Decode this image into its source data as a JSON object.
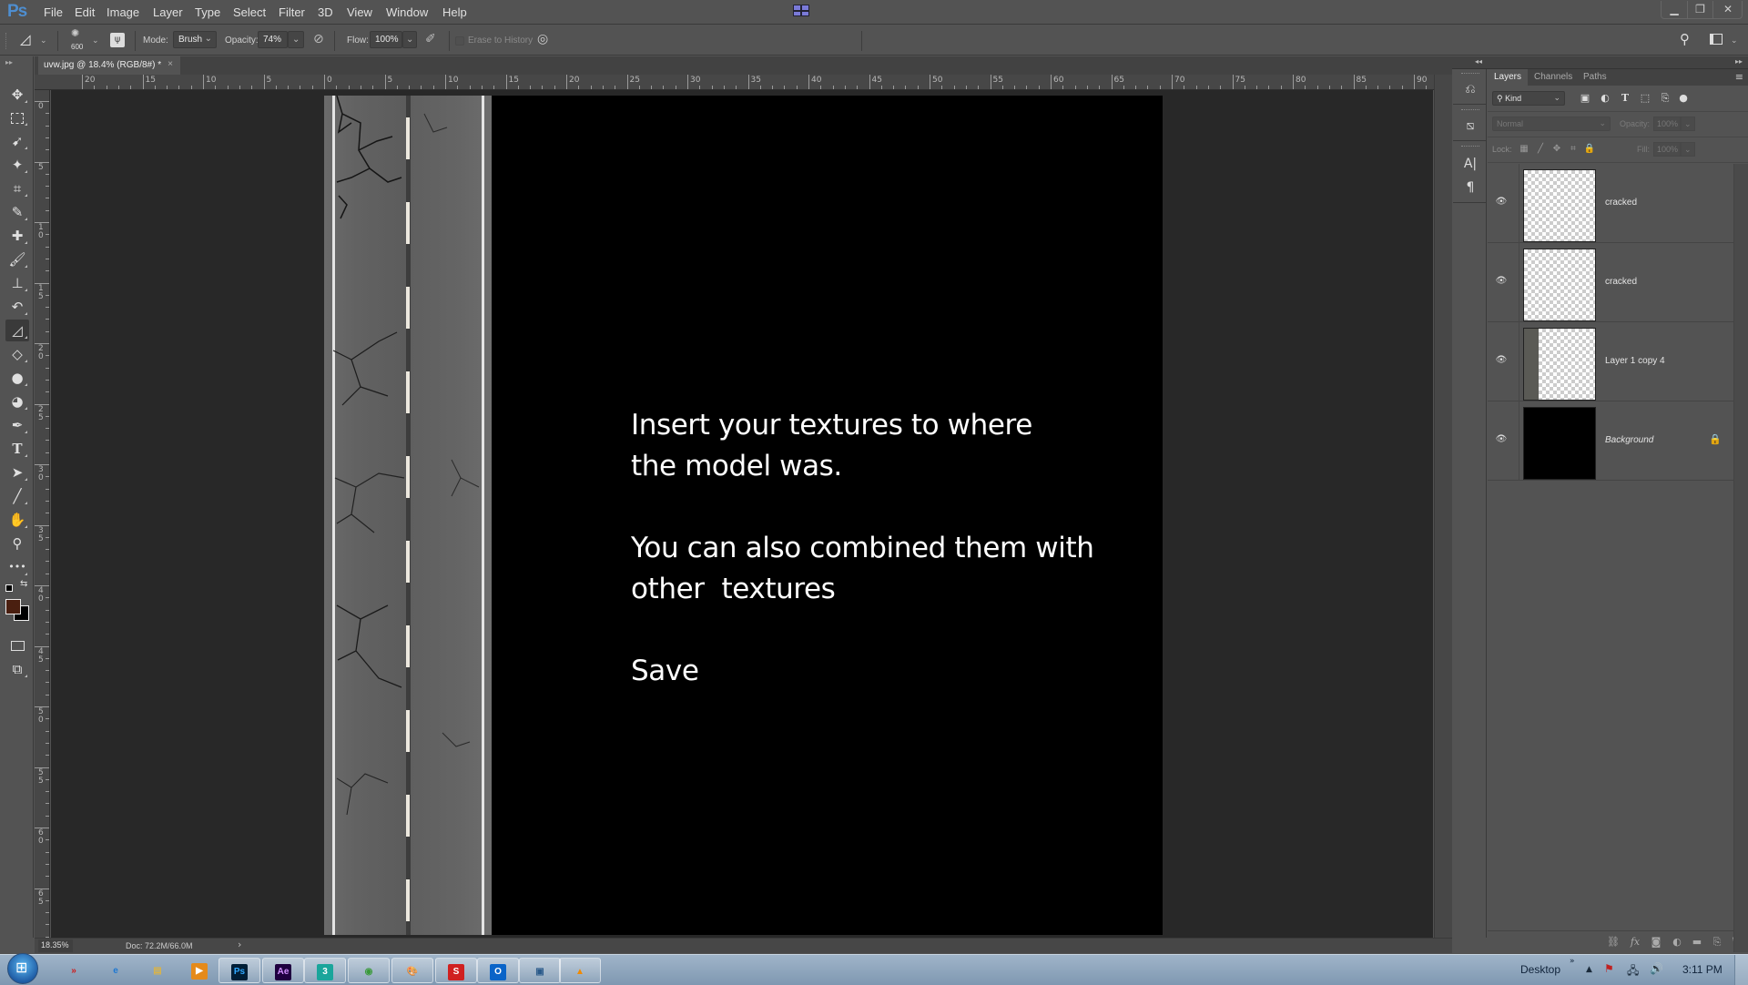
{
  "app": {
    "logo": "Ps",
    "menu": [
      "File",
      "Edit",
      "Image",
      "Layer",
      "Type",
      "Select",
      "Filter",
      "3D",
      "View",
      "Window",
      "Help"
    ],
    "window_buttons": {
      "minimize": "▁",
      "restore": "❐",
      "close": "✕"
    }
  },
  "options_bar": {
    "tool_icon": "eraser-icon",
    "brush_size": "600",
    "mode_label": "Mode:",
    "mode_value": "Brush",
    "opacity_label": "Opacity:",
    "opacity_value": "74%",
    "flow_label": "Flow:",
    "flow_value": "100%",
    "erase_to_history_label": "Erase to History",
    "erase_to_history_checked": false
  },
  "document_tab": {
    "title": "uvw.jpg @ 18.4% (RGB/8#) *",
    "close": "×"
  },
  "rulers": {
    "top": [
      "20",
      "15",
      "10",
      "5",
      "0",
      "5",
      "10",
      "15",
      "20",
      "25",
      "30",
      "35",
      "40",
      "45",
      "50",
      "55",
      "60",
      "65",
      "70",
      "75",
      "80",
      "85",
      "90"
    ],
    "left": [
      "0",
      "5",
      "10",
      "15",
      "20",
      "25",
      "30",
      "35",
      "40",
      "45",
      "50",
      "55",
      "60",
      "65"
    ]
  },
  "toolbar": {
    "tools": [
      {
        "name": "move-tool",
        "glyph": "✥"
      },
      {
        "name": "marquee-tool",
        "glyph": "⬚"
      },
      {
        "name": "lasso-tool",
        "glyph": "➹"
      },
      {
        "name": "magic-wand-tool",
        "glyph": "⁄"
      },
      {
        "name": "crop-tool",
        "glyph": "⌗"
      },
      {
        "name": "eyedropper-tool",
        "glyph": "⁄"
      },
      {
        "name": "healing-brush-tool",
        "glyph": "✚"
      },
      {
        "name": "brush-tool",
        "glyph": "╱"
      },
      {
        "name": "clone-stamp-tool",
        "glyph": "⊥"
      },
      {
        "name": "history-brush-tool",
        "glyph": "↶"
      },
      {
        "name": "eraser-tool",
        "glyph": "◿"
      },
      {
        "name": "paint-bucket-tool",
        "glyph": "◇"
      },
      {
        "name": "blur-tool",
        "glyph": "💧"
      },
      {
        "name": "dodge-tool",
        "glyph": "●"
      },
      {
        "name": "pen-tool",
        "glyph": "✒"
      },
      {
        "name": "type-tool",
        "glyph": "T"
      },
      {
        "name": "path-selection-tool",
        "glyph": "➤"
      },
      {
        "name": "line-tool",
        "glyph": "╱"
      },
      {
        "name": "hand-tool",
        "glyph": "✋"
      },
      {
        "name": "zoom-tool",
        "glyph": "⚲"
      },
      {
        "name": "more-tools",
        "glyph": "•••"
      }
    ],
    "active_tool": "eraser-tool",
    "foreground_color": "#4a1f10",
    "background_color": "#000000"
  },
  "canvas": {
    "instructions": "Insert your textures to where\nthe model was.\n\nYou can also combined them with\nother  textures\n\nSave"
  },
  "status_bar": {
    "zoom": "18.35%",
    "doc_info": "Doc: 72.2M/66.0M",
    "arrow": "›"
  },
  "layers_panel": {
    "tabs": [
      "Layers",
      "Channels",
      "Paths"
    ],
    "active_tab": "Layers",
    "filter_kind": "Kind",
    "blend_mode": "Normal",
    "opacity_label": "Opacity:",
    "opacity_value": "100%",
    "lock_label": "Lock:",
    "fill_label": "Fill:",
    "fill_value": "100%",
    "layers": [
      {
        "name": "cracked",
        "visible": true,
        "thumb": "transparent",
        "locked": false,
        "italic": false
      },
      {
        "name": "cracked",
        "visible": true,
        "thumb": "transparent",
        "locked": false,
        "italic": false
      },
      {
        "name": "Layer 1 copy 4",
        "visible": true,
        "thumb": "road",
        "locked": false,
        "italic": false
      },
      {
        "name": "Background",
        "visible": true,
        "thumb": "black",
        "locked": true,
        "italic": true
      }
    ]
  },
  "taskbar": {
    "apps": [
      {
        "name": "app-red-arrows",
        "label": "»",
        "color": "#d01818",
        "bg": "transparent"
      },
      {
        "name": "internet-explorer",
        "label": "e",
        "color": "#1e78d2",
        "bg": "transparent"
      },
      {
        "name": "file-explorer",
        "label": "▤",
        "color": "#d8b34a",
        "bg": "transparent"
      },
      {
        "name": "media-player",
        "label": "▶",
        "color": "#ffffff",
        "bg": "#e58a1a"
      },
      {
        "name": "photoshop",
        "label": "Ps",
        "color": "#31a8ff",
        "bg": "#001e36"
      },
      {
        "name": "after-effects",
        "label": "Ae",
        "color": "#d291ff",
        "bg": "#1f0040"
      },
      {
        "name": "3ds-max",
        "label": "3",
        "color": "#ffffff",
        "bg": "#1aa59b"
      },
      {
        "name": "chrome",
        "label": "◉",
        "color": "#3a9a3a",
        "bg": "transparent"
      },
      {
        "name": "paint",
        "label": "🎨",
        "color": "#333",
        "bg": "transparent"
      },
      {
        "name": "sketchup",
        "label": "S",
        "color": "#ffffff",
        "bg": "#d02020"
      },
      {
        "name": "outlook",
        "label": "O",
        "color": "#ffffff",
        "bg": "#0a64c8"
      },
      {
        "name": "photo-viewer",
        "label": "▣",
        "color": "#2a5a8a",
        "bg": "transparent"
      },
      {
        "name": "vlc",
        "label": "▲",
        "color": "#f08a00",
        "bg": "transparent"
      }
    ],
    "desktop_label": "Desktop",
    "clock": "3:11 PM"
  }
}
